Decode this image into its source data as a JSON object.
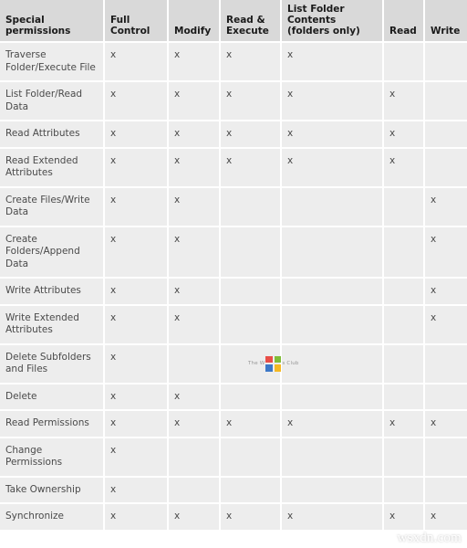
{
  "table": {
    "name": "ntfs-special-permissions-matrix",
    "columns": [
      {
        "key": "special_permissions",
        "label": "Special permissions"
      },
      {
        "key": "full_control",
        "label": "Full Control"
      },
      {
        "key": "modify",
        "label": "Modify"
      },
      {
        "key": "read_execute",
        "label": "Read & Execute"
      },
      {
        "key": "list_folder_contents",
        "label": "List Folder Contents (folders only)"
      },
      {
        "key": "read",
        "label": "Read"
      },
      {
        "key": "write",
        "label": "Write"
      }
    ],
    "mark": "x",
    "rows": [
      {
        "label": "Traverse Folder/Execute File",
        "marks": [
          "x",
          "x",
          "x",
          "x",
          "",
          ""
        ]
      },
      {
        "label": "List Folder/Read Data",
        "marks": [
          "x",
          "x",
          "x",
          "x",
          "x",
          ""
        ]
      },
      {
        "label": "Read Attributes",
        "marks": [
          "x",
          "x",
          "x",
          "x",
          "x",
          ""
        ]
      },
      {
        "label": "Read Extended Attributes",
        "marks": [
          "x",
          "x",
          "x",
          "x",
          "x",
          ""
        ]
      },
      {
        "label": "Create Files/Write Data",
        "marks": [
          "x",
          "x",
          "",
          "",
          "",
          "x"
        ]
      },
      {
        "label": "Create Folders/Append Data",
        "marks": [
          "x",
          "x",
          "",
          "",
          "",
          "x"
        ]
      },
      {
        "label": "Write Attributes",
        "marks": [
          "x",
          "x",
          "",
          "",
          "",
          "x"
        ]
      },
      {
        "label": "Write Extended Attributes",
        "marks": [
          "x",
          "x",
          "",
          "",
          "",
          "x"
        ]
      },
      {
        "label": "Delete Subfolders and Files",
        "marks": [
          "x",
          "",
          "",
          "",
          "",
          ""
        ]
      },
      {
        "label": "Delete",
        "marks": [
          "x",
          "x",
          "",
          "",
          "",
          ""
        ]
      },
      {
        "label": "Read Permissions",
        "marks": [
          "x",
          "x",
          "x",
          "x",
          "x",
          "x"
        ]
      },
      {
        "label": "Change Permissions",
        "marks": [
          "x",
          "",
          "",
          "",
          "",
          ""
        ]
      },
      {
        "label": "Take Ownership",
        "marks": [
          "x",
          "",
          "",
          "",
          "",
          ""
        ]
      },
      {
        "label": "Synchronize",
        "marks": [
          "x",
          "x",
          "x",
          "x",
          "x",
          "x"
        ]
      }
    ]
  },
  "watermarks": {
    "windows_club": {
      "text_pre": "The W",
      "text_post": "s Club",
      "colors": {
        "red": "#e8413a",
        "green": "#77b828",
        "blue": "#2f6fc4",
        "yellow": "#f5b412"
      }
    },
    "site": {
      "text": "wsxdn.com"
    }
  },
  "colors": {
    "header_bg": "#d9d9d9",
    "cell_bg": "#ededed",
    "grid": "#ffffff",
    "header_text": "#1a1a1a",
    "body_text": "#4a4a4a"
  }
}
